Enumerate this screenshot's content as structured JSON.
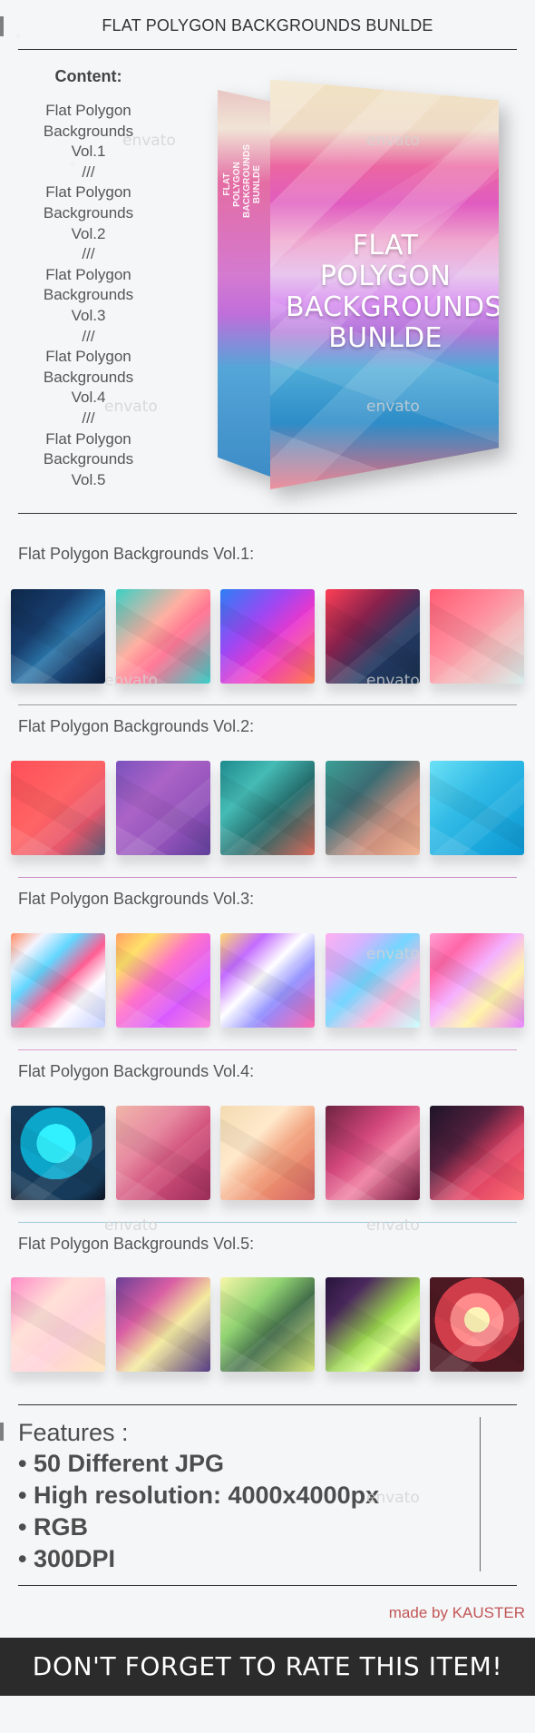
{
  "header": {
    "title": "FLAT POLYGON BACKGROUNDS BUNLDE"
  },
  "content": {
    "title": "Content:",
    "lines": [
      "Flat Polygon",
      "Backgrounds",
      "Vol.1",
      "///",
      "Flat Polygon",
      "Backgrounds",
      "Vol.2",
      "///",
      "Flat Polygon",
      "Backgrounds",
      "Vol.3",
      "///",
      "Flat Polygon",
      "Backgrounds",
      "Vol.4",
      "///",
      "Flat Polygon",
      "Backgrounds",
      "Vol.5"
    ]
  },
  "box": {
    "side_lines": [
      "FLAT POLYGON",
      "BACKGROUNDS",
      "BUNLDE"
    ],
    "front_lines": [
      "FLAT POLYGON",
      "BACKGROUNDS",
      "BUNLDE"
    ]
  },
  "sections": [
    {
      "title": "Flat Polygon Backgrounds Vol.1:",
      "rule_color": "#9a9a9a",
      "thumbs": [
        {
          "gradient": "linear-gradient(135deg, #0e2748 0%, #173d6d 35%, #2a74a7 55%, #1a3f6d 75%, #0a1b35 100%)"
        },
        {
          "gradient": "linear-gradient(135deg, #3ad0c4 0%, #ffb0a2 40%, #ff6e8f 60%, #39d0c8 100%)"
        },
        {
          "gradient": "linear-gradient(135deg, #2d7ff6 0%, #9b48f3 35%, #ec36ca 60%, #ff7d4b 100%)"
        },
        {
          "gradient": "linear-gradient(135deg, #ff3f55 0%, #87214c 35%, #233861 65%, #18304e 100%)"
        },
        {
          "gradient": "linear-gradient(135deg, #ff5d73 0%, #ff8c9c 40%, #f2b8b8 65%, #d8f0ee 100%)"
        }
      ]
    },
    {
      "title": "Flat Polygon Backgrounds Vol.2:",
      "rule_color": "#c98cc8",
      "thumbs": [
        {
          "gradient": "linear-gradient(135deg, #ff4f58 0%, #ff6464 45%, #e6576c 72%, #55607a 100%)"
        },
        {
          "gradient": "linear-gradient(135deg, #7a52bd 0%, #ab63c7 35%, #8f51b8 70%, #5e3f99 100%)"
        },
        {
          "gradient": "linear-gradient(135deg, #1e8a8d 0%, #45bbb5 30%, #226666 60%, #db6a5b 100%)"
        },
        {
          "gradient": "linear-gradient(135deg, #3b9f95 0%, #3c6c74 35%, #c78a79 65%, #f1b695 100%)"
        },
        {
          "gradient": "linear-gradient(135deg, #6be1f6 0%, #32bbe6 40%, #1ba9dd 70%, #0d95cf 100%)"
        }
      ]
    },
    {
      "title": "Flat Polygon Backgrounds Vol.3:",
      "rule_color": "#d99fcb",
      "thumbs": [
        {
          "gradient": "linear-gradient(135deg, #ff8d65 0%, #f2f4ff 18%, #63d6ff 36%, #ff5d92 55%, #fdfbff 72%, #c4d0ff 100%)"
        },
        {
          "gradient": "linear-gradient(135deg, #ff9f64 0%, #ffe06a 20%, #ff73c8 44%, #d959ff 70%, #fd8cda 100%)"
        },
        {
          "gradient": "linear-gradient(135deg, #ffd86c 0%, #c36cff 24%, #ffffff 45%, #8e8cff 65%, #ff6aaf 100%)"
        },
        {
          "gradient": "linear-gradient(135deg, #ffb0f0 0%, #d3b3ff 24%, #74d6ff 46%, #ffb6db 70%, #c8ffff 100%)"
        },
        {
          "gradient": "linear-gradient(135deg, #ff9ed4 0%, #ff67a7 22%, #f5b0ff 45%, #fff3a6 68%, #e784ff 100%)"
        }
      ]
    },
    {
      "title": "Flat Polygon Backgrounds Vol.4:",
      "rule_color": "#9ec8d7",
      "thumbs": [
        {
          "gradient": "radial-gradient(circle at 48% 40%, #31f0ff 0 26%, #0da6cb 26% 48%, #163a59 48% 75%, #090f1e 100%)"
        },
        {
          "gradient": "linear-gradient(135deg, #f0b5a8 0%, #e78aa1 35%, #d04e79 60%, #992d59 100%)"
        },
        {
          "gradient": "linear-gradient(135deg, #f3dab0 0%, #ffe9cc 35%, #ef946f 62%, #d46565 100%)"
        },
        {
          "gradient": "linear-gradient(135deg, #6e2441 0%, #d1467b 38%, #f07ea1 60%, #6a1b3c 100%)"
        },
        {
          "gradient": "linear-gradient(135deg, #1d1429 0%, #52203d 35%, #db3f62 62%, #ff6b73 100%)"
        }
      ]
    },
    {
      "title": "Flat Polygon Backgrounds Vol.5:",
      "rule_color": "#9c9c9c",
      "thumbs": [
        {
          "gradient": "linear-gradient(135deg, #fe8cc6 0%, #ffe1d8 35%, #ffd0d8 60%, #ffe8bf 100%)"
        },
        {
          "gradient": "linear-gradient(135deg, #6b3f95 0%, #d95ea4 32%, #f4ea9c 58%, #563c85 100%)"
        },
        {
          "gradient": "linear-gradient(135deg, #f7f7a8 0%, #90d272 34%, #426d48 58%, #dbe97d 100%)"
        },
        {
          "gradient": "linear-gradient(135deg, #26153b 0%, #4b285d 24%, #9ad54e 54%, #d7ff84 70%, #6e2f6f 100%)"
        },
        {
          "gradient": "radial-gradient(circle at 50% 45%, #fff4b7 0 18%, #ff8b8c 18% 38%, #cf3d4a 38% 60%, #4c1923 60% 100%)"
        }
      ]
    }
  ],
  "features": {
    "title": "Features :",
    "items": [
      "• 50 Different JPG",
      "• High resolution: 4000x4000px",
      "• RGB",
      "• 300DPI"
    ]
  },
  "credit": {
    "text": "made by KAUSTER"
  },
  "footer": {
    "text": "DON'T FORGET TO RATE THIS ITEM!"
  },
  "watermarks": {
    "text": "envato"
  }
}
